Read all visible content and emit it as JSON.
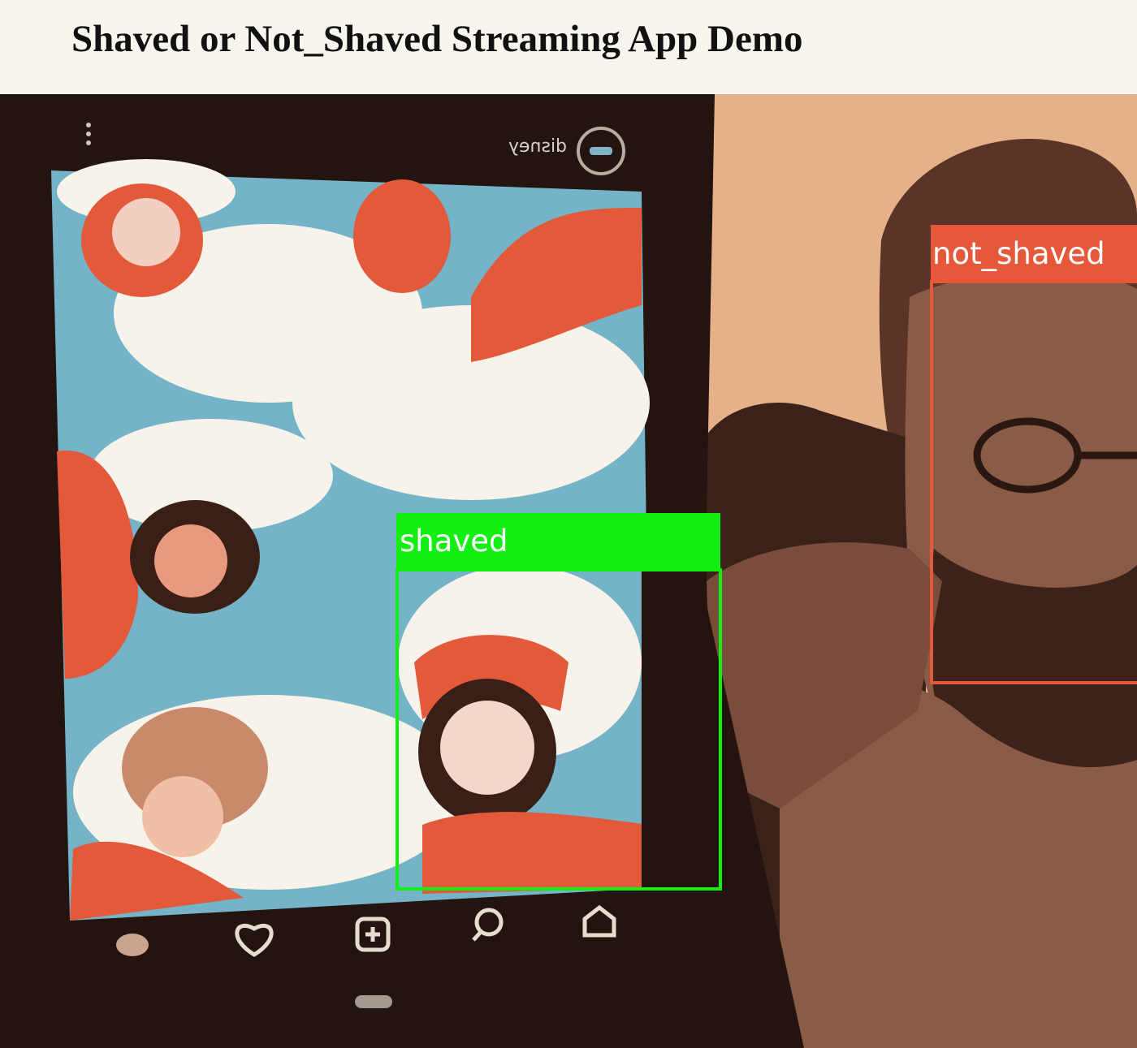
{
  "page": {
    "title": "Shaved or Not_Shaved Streaming App Demo"
  },
  "video": {
    "phone_screen": {
      "username": "disney"
    },
    "detections": [
      {
        "label": "shaved",
        "color": "#13ee13"
      },
      {
        "label": "not_shaved",
        "color": "#e7573a"
      }
    ]
  },
  "colors": {
    "header_bg": "#f7f5ee",
    "title_text": "#111111",
    "shaved_box": "#13ee13",
    "not_shaved_box": "#e7573a",
    "wall": "#e8b48c",
    "sky": "#74b3c8",
    "cloud": "#f7f3ea",
    "shirt_orange": "#e35a3a",
    "phone_body": "#24140f"
  },
  "icons": {
    "phone_nav": [
      "heart-icon",
      "plus-square-icon",
      "search-icon",
      "home-icon"
    ],
    "phone_top": [
      "kebab-menu-icon",
      "avatar"
    ]
  }
}
